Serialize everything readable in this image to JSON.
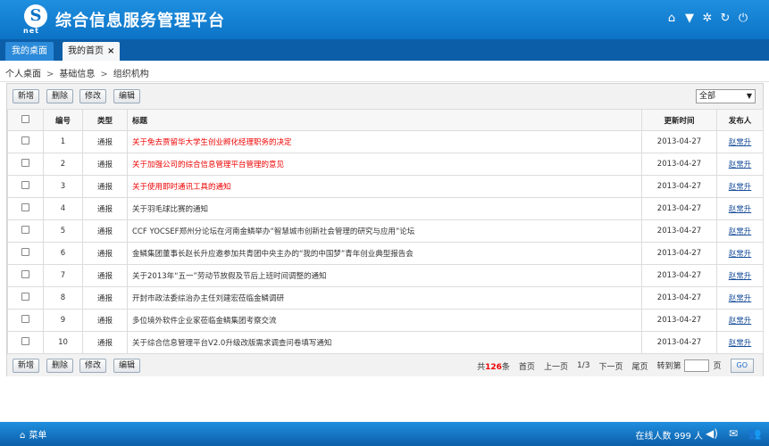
{
  "app": {
    "logo_letter": "S",
    "logo_sub": "net",
    "title": "综合信息服务管理平台"
  },
  "header_icons": [
    "home-icon",
    "shirt-icon",
    "gear-icon",
    "refresh-icon",
    "power-icon"
  ],
  "tabs": [
    {
      "label": "我的桌面"
    },
    {
      "label": "我的首页",
      "close": "×"
    }
  ],
  "breadcrumb": [
    "个人桌面",
    "基础信息",
    "组织机构"
  ],
  "breadcrumb_sep": ">",
  "toolbar": {
    "add": "新增",
    "delete": "删除",
    "modify": "修改",
    "edit": "编辑"
  },
  "filter": {
    "selected": "全部"
  },
  "table": {
    "headers": {
      "number": "编号",
      "type": "类型",
      "title": "标题",
      "updated": "更新时间",
      "publisher": "发布人"
    },
    "rows": [
      {
        "num": "1",
        "type": "通报",
        "title": "关于免去贾留华大学生创业孵化经理职务的决定",
        "date": "2013-04-27",
        "publisher": "赵常升",
        "red": true
      },
      {
        "num": "2",
        "type": "通报",
        "title": "关于加强公司的综合信息管理平台管理的意见",
        "date": "2013-04-27",
        "publisher": "赵常升",
        "red": true
      },
      {
        "num": "3",
        "type": "通报",
        "title": "关于使用即时通讯工具的通知",
        "date": "2013-04-27",
        "publisher": "赵常升",
        "red": true
      },
      {
        "num": "4",
        "type": "通报",
        "title": "关于羽毛球比赛的通知",
        "date": "2013-04-27",
        "publisher": "赵常升",
        "red": false
      },
      {
        "num": "5",
        "type": "通报",
        "title": "CCF YOCSEF郑州分论坛在河南金鳞举办“智慧城市创新社会管理的研究与应用”论坛",
        "date": "2013-04-27",
        "publisher": "赵常升",
        "red": false
      },
      {
        "num": "6",
        "type": "通报",
        "title": "金鳞集团董事长赵长升应邀参加共青团中央主办的“我的中国梦”青年创业典型报告会",
        "date": "2013-04-27",
        "publisher": "赵常升",
        "red": false
      },
      {
        "num": "7",
        "type": "通报",
        "title": "关于2013年“五一”劳动节放假及节后上班时间调整的通知",
        "date": "2013-04-27",
        "publisher": "赵常升",
        "red": false
      },
      {
        "num": "8",
        "type": "通报",
        "title": "开封市政法委综治办主任刘建宏莅临金鳞调研",
        "date": "2013-04-27",
        "publisher": "赵常升",
        "red": false
      },
      {
        "num": "9",
        "type": "通报",
        "title": "多位境外软件企业家莅临金鳞集团考察交流",
        "date": "2013-04-27",
        "publisher": "赵常升",
        "red": false
      },
      {
        "num": "10",
        "type": "通报",
        "title": "关于综合信息管理平台V2.0升级改版需求调查问卷填写通知",
        "date": "2013-04-27",
        "publisher": "赵常升",
        "red": false
      }
    ]
  },
  "pager": {
    "total_prefix": "共",
    "total": "126",
    "total_suffix": "条",
    "first": "首页",
    "prev": "上一页",
    "page": "1/3",
    "next": "下一页",
    "last": "尾页",
    "goto": "转到第",
    "page_unit": "页",
    "go": "GO"
  },
  "footer": {
    "menu": "菜单",
    "online_label": "在线人数",
    "online_count": "999",
    "online_unit": "人"
  },
  "footer_icons": [
    "volume-icon",
    "mail-icon",
    "users-icon"
  ]
}
